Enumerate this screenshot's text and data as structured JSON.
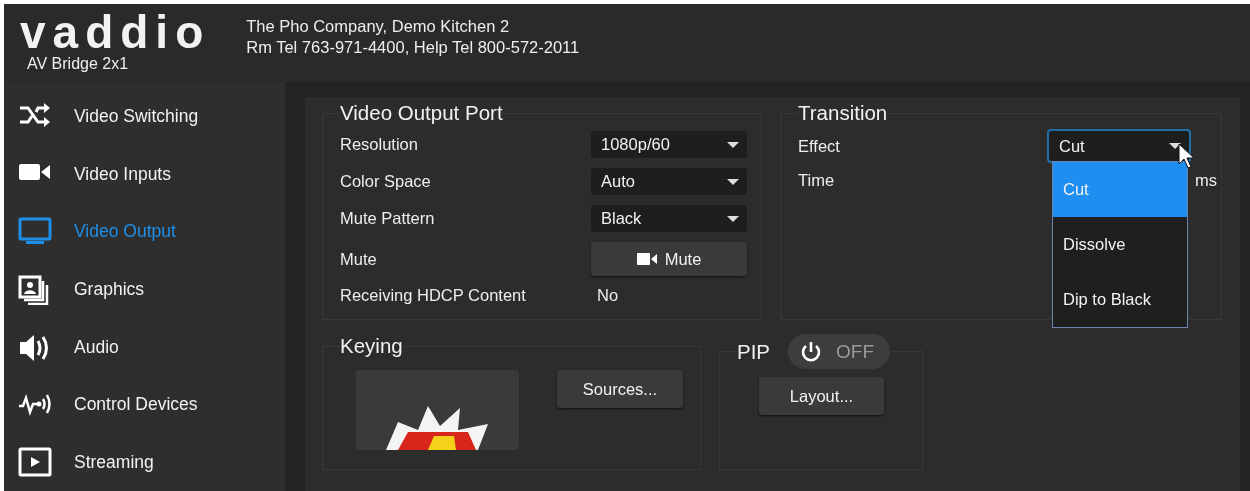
{
  "header": {
    "logo": "vaddio",
    "product": "AV Bridge 2x1",
    "location": "The Pho Company, Demo Kitchen 2",
    "phones": "Rm Tel 763-971-4400, Help Tel 800-572-2011"
  },
  "sidebar": {
    "items": [
      {
        "kind": "switching",
        "label": "Video Switching",
        "selected": false
      },
      {
        "kind": "camera",
        "label": "Video Inputs",
        "selected": false
      },
      {
        "kind": "monitor",
        "label": "Video Output",
        "selected": true
      },
      {
        "kind": "graphics",
        "label": "Graphics",
        "selected": false
      },
      {
        "kind": "audio",
        "label": "Audio",
        "selected": false
      },
      {
        "kind": "control",
        "label": "Control Devices",
        "selected": false
      },
      {
        "kind": "streaming",
        "label": "Streaming",
        "selected": false
      }
    ]
  },
  "video_output_port": {
    "title": "Video Output Port",
    "rows": [
      {
        "kind": "select",
        "label": "Resolution",
        "value": "1080p/60"
      },
      {
        "kind": "select",
        "label": "Color Space",
        "value": "Auto"
      },
      {
        "kind": "select",
        "label": "Mute Pattern",
        "value": "Black"
      },
      {
        "kind": "button",
        "label": "Mute",
        "value": "Mute"
      },
      {
        "kind": "text",
        "label": "Receiving HDCP Content",
        "value": "No"
      }
    ]
  },
  "transition": {
    "title": "Transition",
    "effect": {
      "label": "Effect",
      "value": "Cut",
      "expanded": true,
      "options": [
        {
          "label": "Cut",
          "selected": true
        },
        {
          "label": "Dissolve",
          "selected": false
        },
        {
          "label": "Dip to Black",
          "selected": false
        }
      ]
    },
    "time": {
      "label": "Time",
      "unit": "ms"
    }
  },
  "keying": {
    "title": "Keying",
    "button": "Sources..."
  },
  "pip": {
    "title": "PIP",
    "toggle": {
      "label": "OFF",
      "on": false
    },
    "button": "Layout..."
  }
}
